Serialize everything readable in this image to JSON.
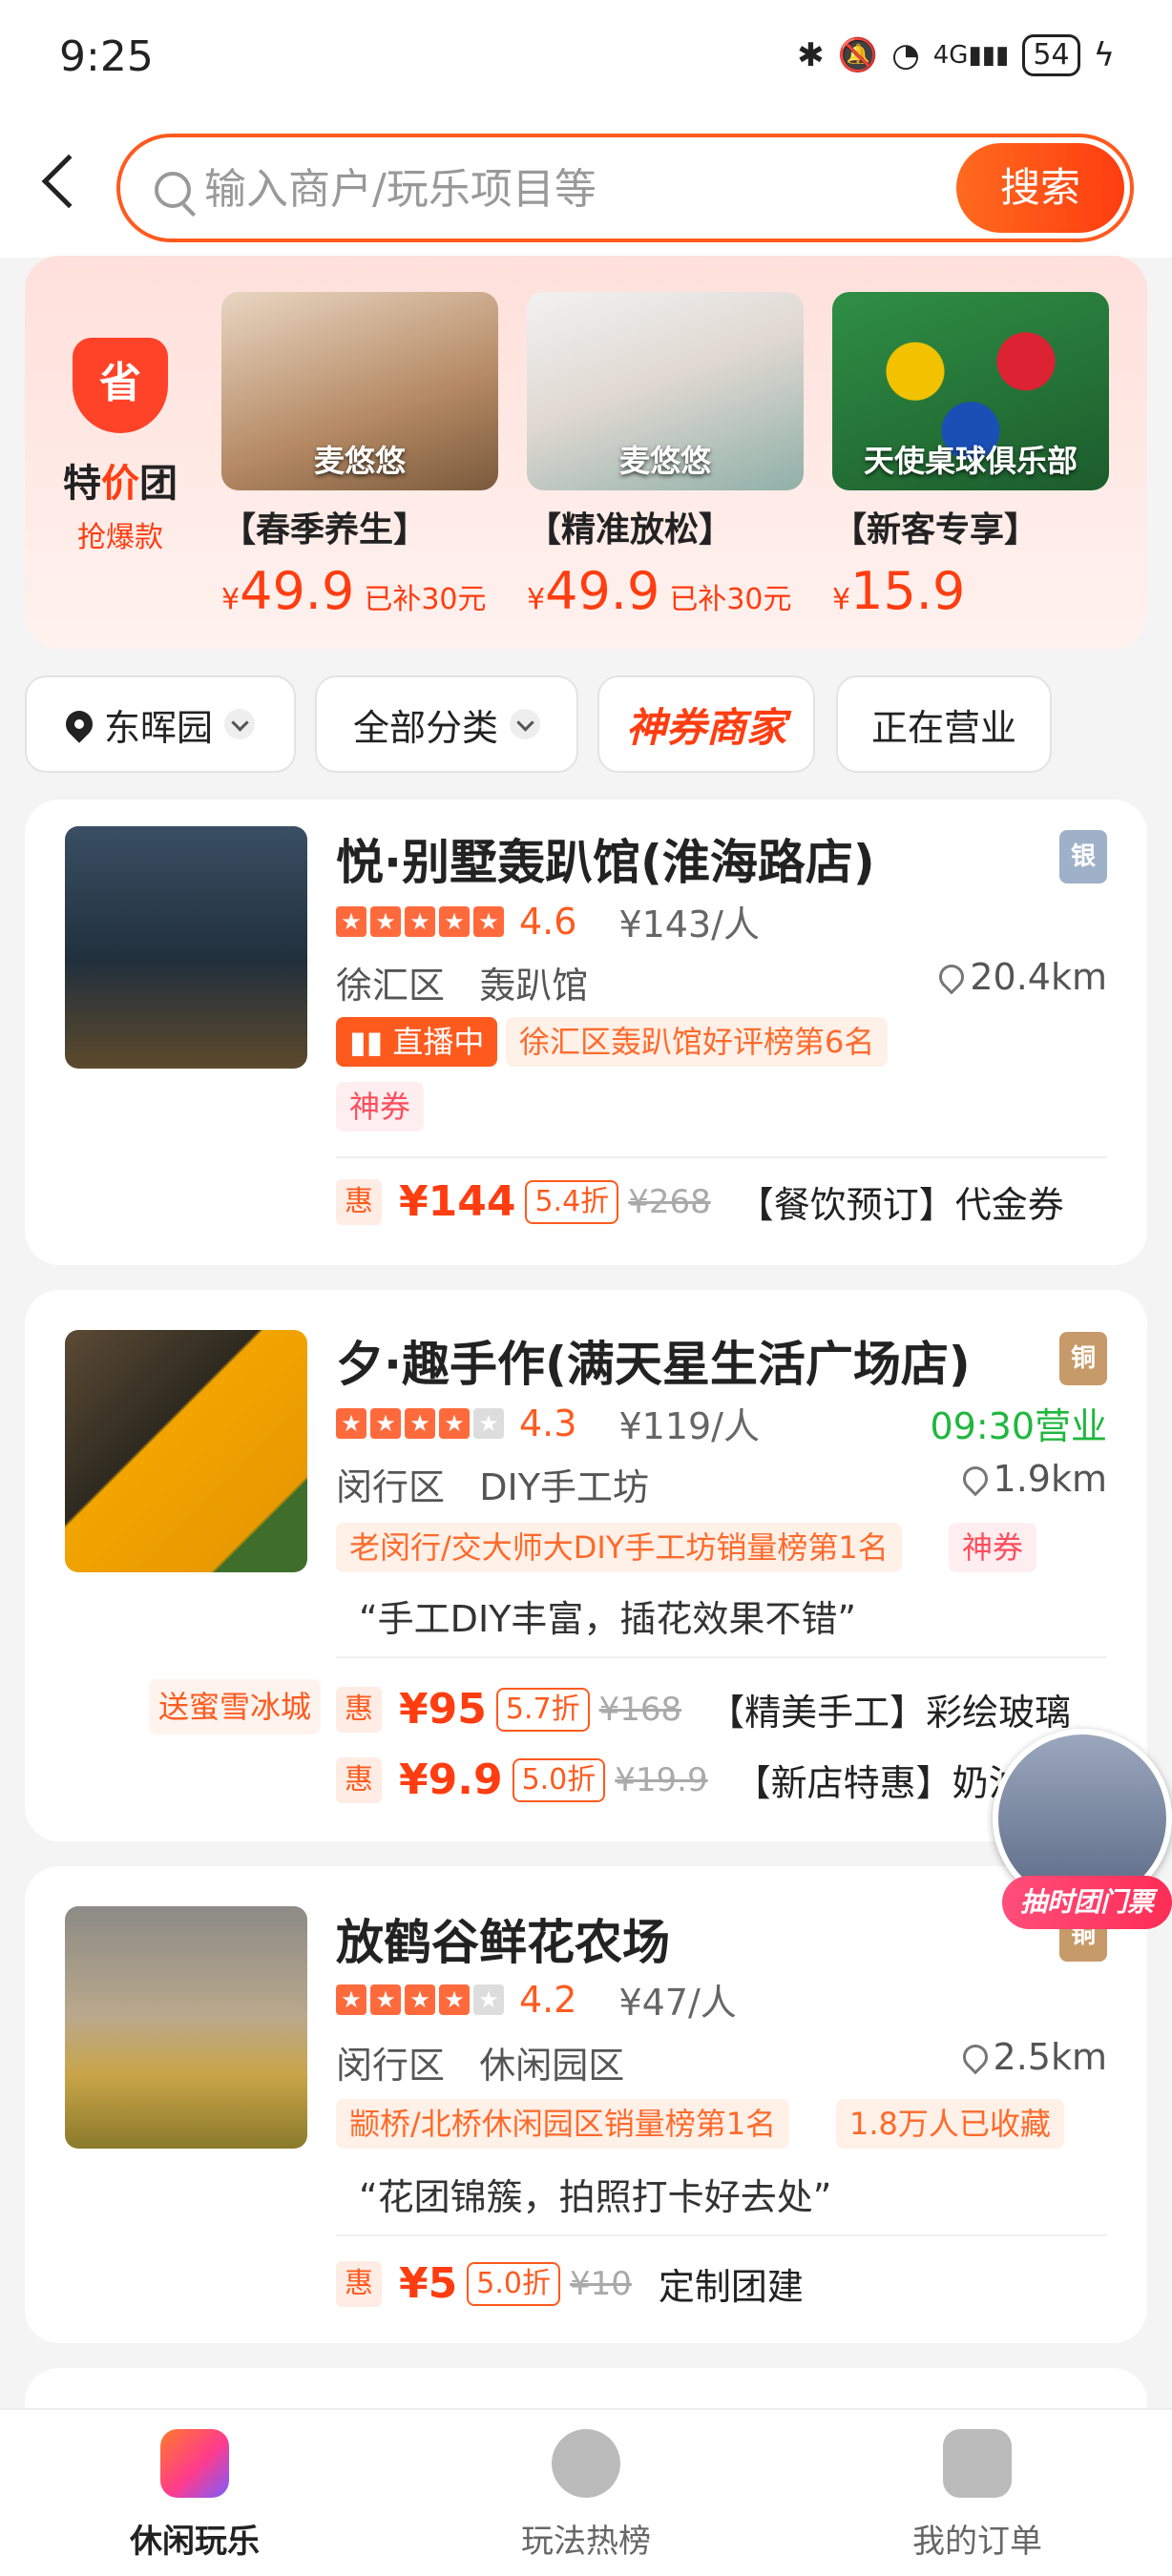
{
  "status_bar": {
    "time": "9:25",
    "battery": "54",
    "icons": [
      "bluetooth-icon",
      "mute-icon",
      "wifi-icon",
      "signal-4g-icon",
      "charging-icon"
    ],
    "net": "4G"
  },
  "search": {
    "placeholder": "输入商户/玩乐项目等",
    "button": "搜索"
  },
  "promo": {
    "logo_icon_text": "省",
    "title_a": "特",
    "title_b": "价",
    "title_c": "团",
    "subtitle": "抢爆款",
    "deals": [
      {
        "caption": "麦悠悠",
        "title": "【春季养生】",
        "currency": "¥",
        "price": "49.9",
        "subsidy": "已补30元"
      },
      {
        "caption": "麦悠悠",
        "title": "【精准放松】",
        "currency": "¥",
        "price": "49.9",
        "subsidy": "已补30元"
      },
      {
        "caption": "天使桌球俱乐部",
        "title": "【新客专享】",
        "currency": "¥",
        "price": "15.9",
        "subsidy": ""
      }
    ]
  },
  "filters": {
    "location": "东晖园",
    "category": "全部分类",
    "brand": "神券商家",
    "open": "正在营业"
  },
  "cards": [
    {
      "name": "悦·别墅轰趴馆(淮海路店)",
      "medal": "银",
      "rating": 4.6,
      "score": "4.6",
      "avg": "¥143/人",
      "district": "徐汇区",
      "type": "轰趴馆",
      "distance": "20.4km",
      "live": "直播中",
      "rank": "徐汇区轰趴馆好评榜第6名",
      "coupon": "神券",
      "offers": [
        {
          "hui": "惠",
          "price": "¥144",
          "discount": "5.4折",
          "orig": "¥268",
          "title": "【餐饮预订】代金券"
        }
      ]
    },
    {
      "name": "夕·趣手作(满天星生活广场店)",
      "medal": "铜",
      "rating": 4.3,
      "score": "4.3",
      "avg": "¥119/人",
      "open": "09:30营业",
      "district": "闵行区",
      "type": "DIY手工坊",
      "distance": "1.9km",
      "rank": "老闵行/交大师大DIY手工坊销量榜第1名",
      "coupon": "神券",
      "quote": "“手工DIY丰富，插花效果不错”",
      "gift": "送蜜雪冰城",
      "offers": [
        {
          "hui": "惠",
          "price": "¥95",
          "discount": "5.7折",
          "orig": "¥168",
          "title": "【精美手工】彩绘玻璃"
        },
        {
          "hui": "惠",
          "price": "¥9.9",
          "discount": "5.0折",
          "orig": "¥19.9",
          "title": "【新店特惠】奶油"
        }
      ]
    },
    {
      "name": "放鹤谷鲜花农场",
      "medal": "铜",
      "rating": 4.2,
      "score": "4.2",
      "avg": "¥47/人",
      "district": "闵行区",
      "type": "休闲园区",
      "distance": "2.5km",
      "rank": "颛桥/北桥休闲园区销量榜第1名",
      "collect": "1.8万人已收藏",
      "quote": "“花团锦簇，拍照打卡好去处”",
      "offers": [
        {
          "hui": "惠",
          "price": "¥5",
          "discount": "5.0折",
          "orig": "¥10",
          "title": "定制团建"
        }
      ]
    }
  ],
  "float_label": "抽时团门票",
  "nav": [
    {
      "label": "休闲玩乐",
      "icon": "leisure-icon"
    },
    {
      "label": "玩法热榜",
      "icon": "compass-icon"
    },
    {
      "label": "我的订单",
      "icon": "order-icon"
    }
  ]
}
